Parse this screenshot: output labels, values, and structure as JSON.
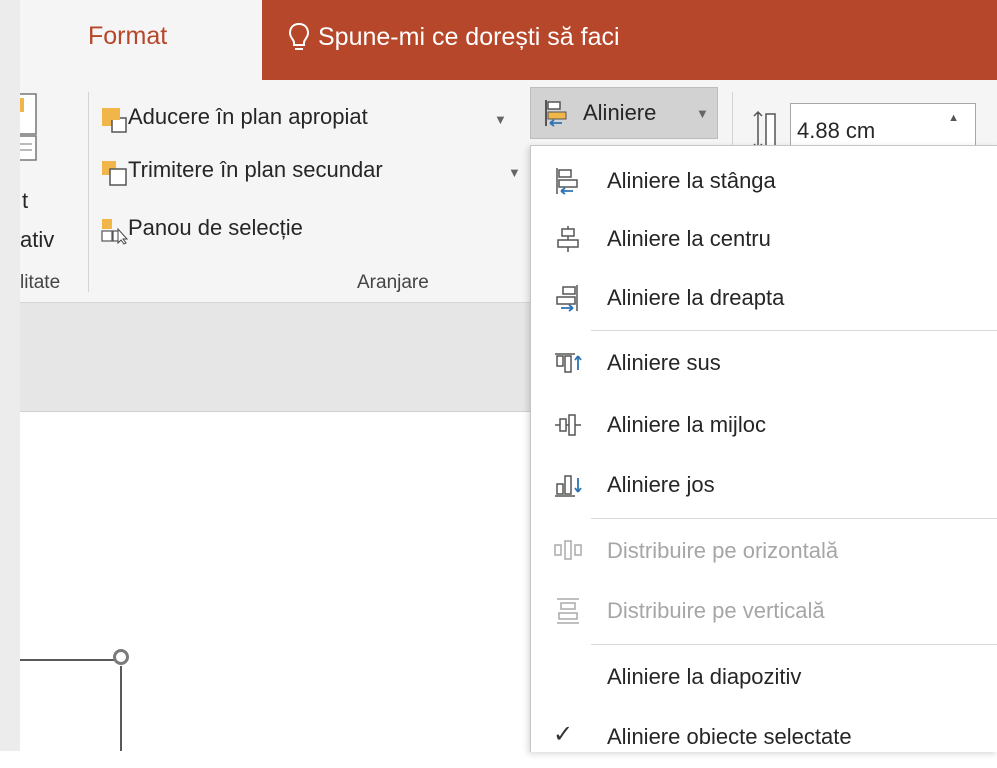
{
  "tabs": {
    "format": "Format",
    "tell_me": "Spune-mi ce dorești să faci"
  },
  "ribbon": {
    "left_partial_lines": [
      "t",
      "ativ"
    ],
    "left_group_label": "litate",
    "arrange": {
      "bring_forward": "Aducere în plan apropiat",
      "send_backward": "Trimitere în plan secundar",
      "selection_pane": "Panou de selecție",
      "group_label": "Aranjare"
    },
    "align_button": "Aliniere",
    "height_value": "4.88 cm"
  },
  "align_menu": {
    "items": [
      {
        "label": "Aliniere la stânga",
        "icon": "align-left-icon",
        "enabled": true
      },
      {
        "label": "Aliniere la centru",
        "icon": "align-center-icon",
        "enabled": true
      },
      {
        "label": "Aliniere la dreapta",
        "icon": "align-right-icon",
        "enabled": true
      },
      {
        "label": "Aliniere sus",
        "icon": "align-top-icon",
        "enabled": true
      },
      {
        "label": "Aliniere la mijloc",
        "icon": "align-middle-icon",
        "enabled": true
      },
      {
        "label": "Aliniere jos",
        "icon": "align-bottom-icon",
        "enabled": true
      },
      {
        "label": "Distribuire pe orizontală",
        "icon": "distribute-horizontal-icon",
        "enabled": false
      },
      {
        "label": "Distribuire pe verticală",
        "icon": "distribute-vertical-icon",
        "enabled": false
      },
      {
        "label": "Aliniere la diapozitiv",
        "icon": "",
        "enabled": true
      },
      {
        "label": "Aliniere obiecte selectate",
        "icon": "checkmark-icon",
        "enabled": true,
        "checked": true
      }
    ]
  },
  "colors": {
    "accent": "#b7472a",
    "ribbon_bg": "#f5f5f5",
    "icon_orange": "#f0b64a",
    "icon_blue": "#2e74b5"
  }
}
